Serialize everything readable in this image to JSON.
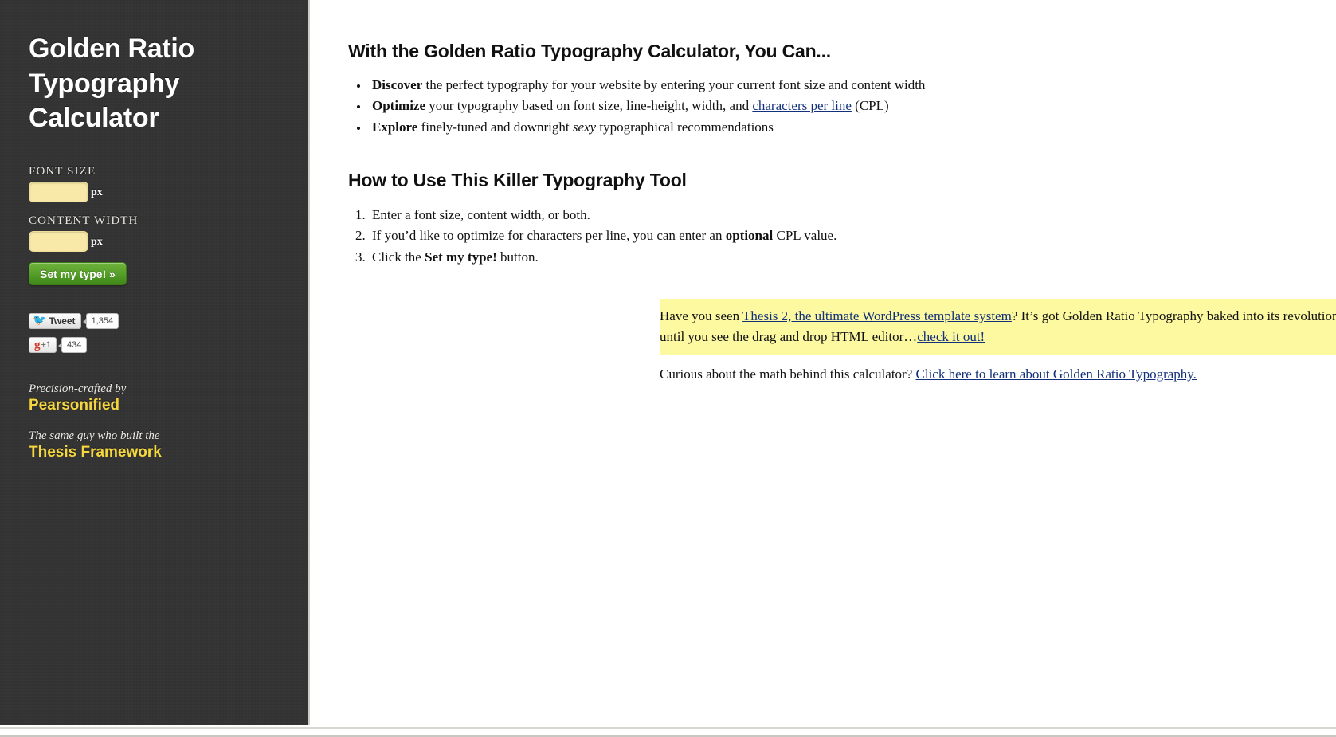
{
  "sidebar": {
    "title": "Golden Ratio Typography Calculator",
    "form": {
      "font_size_label": "FONT SIZE",
      "font_size_value": "",
      "font_size_unit": "px",
      "content_width_label": "CONTENT WIDTH",
      "content_width_value": "",
      "content_width_unit": "px",
      "submit_label": "Set my type! »"
    },
    "social": {
      "tweet_label": "Tweet",
      "tweet_count": "1,354",
      "gplus_g": "g",
      "gplus_plus": "+1",
      "gplus_count": "434"
    },
    "credits": {
      "line1": "Precision-crafted by",
      "brand1": "Pearsonified",
      "line2": "The same guy who built the",
      "brand2": "Thesis Framework"
    }
  },
  "content": {
    "benefits_heading": "With the Golden Ratio Typography Calculator, You Can...",
    "benefits": [
      {
        "lead": "Discover",
        "rest": " the perfect typography for your website by entering your current font size and content width"
      },
      {
        "lead": "Optimize",
        "rest_before_link": " your typography based on font size, line-height, width, and ",
        "link": "characters per line",
        "rest_after_link": " (CPL)"
      },
      {
        "lead": "Explore",
        "rest_before_em": " finely-tuned and downright ",
        "em": "sexy",
        "rest_after_em": " typographical recommendations"
      }
    ],
    "howto_heading": "How to Use This Killer Typography Tool",
    "howto": [
      {
        "text": "Enter a font size, content width, or both."
      },
      {
        "before_bold": "If you’d like to optimize for characters per line, you can enter an ",
        "bold": "optional",
        "after_bold": " CPL value."
      },
      {
        "before_bold": "Click the ",
        "bold": "Set my type!",
        "after_bold": " button."
      }
    ],
    "promo": {
      "before_link": "Have you seen ",
      "link": "Thesis 2, the ultimate WordPress template system",
      "after_link": "? It’s got Golden Ratio Typography baked into its revolutionary new CSS editor, and just wait until you see the drag and drop HTML editor…",
      "link2": "check it out!"
    },
    "closing": {
      "before_link": "Curious about the math behind this calculator? ",
      "link": "Click here to learn about Golden Ratio Typography."
    }
  },
  "colors": {
    "sidebar_bg": "#343434",
    "accent_yellow": "#f5d73f",
    "input_bg": "#f8e9a8",
    "button_green": "#57a02a",
    "link_blue": "#13307a",
    "promo_bg": "#fcf9a0"
  }
}
